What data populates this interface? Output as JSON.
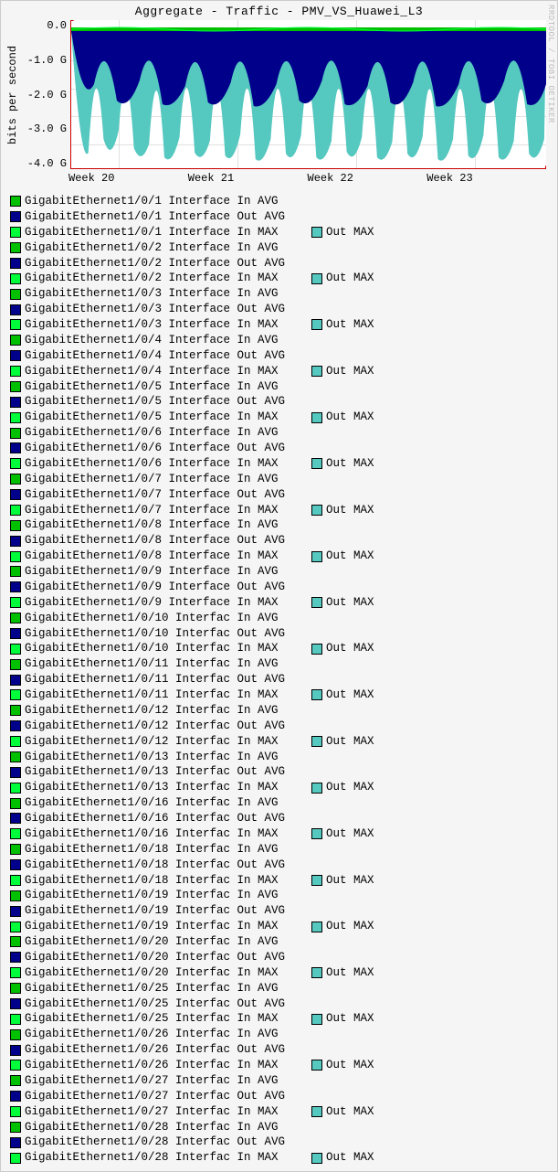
{
  "chart_data": {
    "type": "area",
    "title": "Aggregate - Traffic - PMV_VS_Huawei_L3",
    "ylabel": "bits per second",
    "xlabel": "",
    "ylim": [
      -4.5,
      0.3
    ],
    "y_ticks": [
      "0.0",
      "-1.0 G",
      "-2.0 G",
      "-3.0 G",
      "-4.0 G"
    ],
    "x_ticks": [
      "Week 20",
      "Week 21",
      "Week 22",
      "Week 23"
    ],
    "description": "Stacked negative-going traffic from ~0 down to approx -4.5 G; dense repeating daily pattern across 4 weeks. Light green (In AVG), dark blue (Out AVG), bright green (In MAX), cyan (Out MAX).",
    "series_colors": {
      "in_avg": "#00c000",
      "out_avg": "#00008b",
      "in_max": "#00ff3a",
      "out_max": "#55c8c0"
    }
  },
  "credit": "RRDTOOL / TOBI OETIKER",
  "legend": {
    "interfaces": [
      {
        "if": "GigabitEthernet1/0/1",
        "word": "Interface"
      },
      {
        "if": "GigabitEthernet1/0/2",
        "word": "Interface"
      },
      {
        "if": "GigabitEthernet1/0/3",
        "word": "Interface"
      },
      {
        "if": "GigabitEthernet1/0/4",
        "word": "Interface"
      },
      {
        "if": "GigabitEthernet1/0/5",
        "word": "Interface"
      },
      {
        "if": "GigabitEthernet1/0/6",
        "word": "Interface"
      },
      {
        "if": "GigabitEthernet1/0/7",
        "word": "Interface"
      },
      {
        "if": "GigabitEthernet1/0/8",
        "word": "Interface"
      },
      {
        "if": "GigabitEthernet1/0/9",
        "word": "Interface"
      },
      {
        "if": "GigabitEthernet1/0/10",
        "word": "Interfac"
      },
      {
        "if": "GigabitEthernet1/0/11",
        "word": "Interfac"
      },
      {
        "if": "GigabitEthernet1/0/12",
        "word": "Interfac"
      },
      {
        "if": "GigabitEthernet1/0/13",
        "word": "Interfac"
      },
      {
        "if": "GigabitEthernet1/0/16",
        "word": "Interfac"
      },
      {
        "if": "GigabitEthernet1/0/18",
        "word": "Interfac"
      },
      {
        "if": "GigabitEthernet1/0/19",
        "word": "Interfac"
      },
      {
        "if": "GigabitEthernet1/0/20",
        "word": "Interfac"
      },
      {
        "if": "GigabitEthernet1/0/25",
        "word": "Interfac"
      },
      {
        "if": "GigabitEthernet1/0/26",
        "word": "Interfac"
      },
      {
        "if": "GigabitEthernet1/0/27",
        "word": "Interfac"
      },
      {
        "if": "GigabitEthernet1/0/28",
        "word": "Interfac"
      }
    ],
    "labels": {
      "in_avg": "In AVG",
      "out_avg": "Out AVG",
      "in_max": "In MAX",
      "out_max": "Out MAX"
    }
  }
}
